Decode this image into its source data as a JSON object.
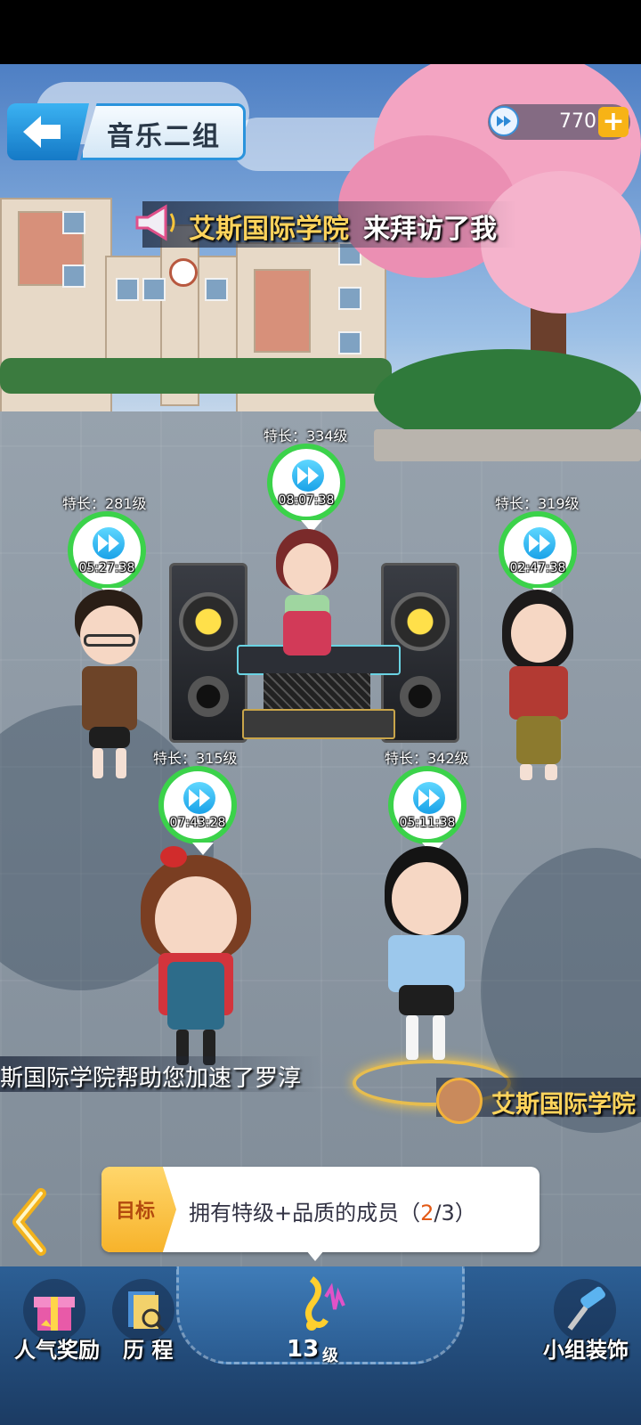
{
  "header": {
    "title": "音乐二组",
    "currency_value": "770",
    "plus_label": "+"
  },
  "announcement": {
    "visitor": "艾斯国际学院",
    "message": "来拜访了我"
  },
  "members": [
    {
      "level": "特长：334级",
      "timer": "08:07:38"
    },
    {
      "level": "特长：281级",
      "timer": "05:27:38"
    },
    {
      "level": "特长：319级",
      "timer": "02:47:38"
    },
    {
      "level": "特长：315级",
      "timer": "07:43:28"
    },
    {
      "level": "特长：342级",
      "timer": "05:11:38"
    }
  ],
  "ticker": {
    "text": "斯国际学院帮助您加速了罗淳",
    "visitor_name": "艾斯国际学院"
  },
  "goal": {
    "tag": "目标",
    "text": "拥有特级+品质的成员（",
    "progress": "2",
    "total": "/3）"
  },
  "nav": {
    "popularity_reward": "人气奖励",
    "history": "历 程",
    "level": "13",
    "level_unit": "级",
    "group_decor": "小组装饰"
  },
  "colors": {
    "accent_blue": "#1aa2e8",
    "timer_green": "#3bd24a",
    "highlight_yellow": "#ffd45c",
    "goal_orange": "#e35a16"
  },
  "icons": [
    "back-arrow-icon",
    "fast-forward-icon",
    "plus-icon",
    "megaphone-icon",
    "chevron-left-icon",
    "gift-icon",
    "book-icon",
    "music-note-icon",
    "paint-roller-icon"
  ]
}
